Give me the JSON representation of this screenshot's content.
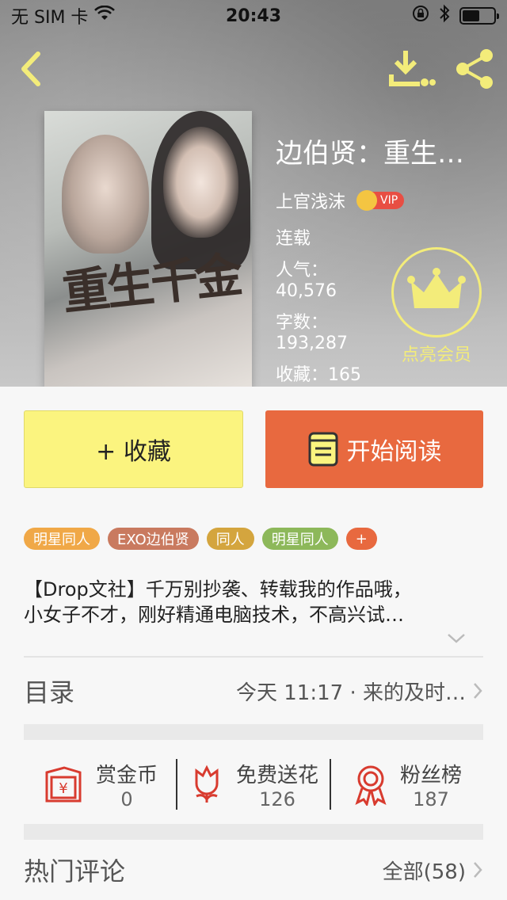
{
  "status_bar": {
    "carrier": "无 SIM 卡",
    "time": "20:43",
    "icons": [
      "wifi-icon",
      "rotation-lock-icon",
      "bluetooth-icon",
      "battery-icon"
    ]
  },
  "nav": {
    "icons": [
      "back-arrow-icon",
      "download-icon",
      "share-icon"
    ],
    "accent": "#f3ec7a"
  },
  "book": {
    "title": "边伯贤：重生…",
    "author": "上官浅沫",
    "vip_label": "VIP",
    "status": "连载",
    "popularity_label": "人气：",
    "popularity_value": "40,576",
    "words_label": "字数：",
    "words_value": "193,287",
    "favorites": "收藏：165",
    "cover_art_text": "重生千金"
  },
  "vip_member": {
    "label": "点亮会员",
    "icon": "crown-icon"
  },
  "actions": {
    "favorite_label": "+ 收藏",
    "read_label": "开始阅读",
    "favorite_color": "#fbf47f",
    "read_color": "#e8693f"
  },
  "tags": [
    {
      "label": "明星同人",
      "color": "#f0a847"
    },
    {
      "label": "EXO边伯贤",
      "color": "#c97a5f"
    },
    {
      "label": "同人",
      "color": "#d4a53e"
    },
    {
      "label": "明星同人",
      "color": "#8db85a"
    },
    {
      "label": "+",
      "color": "#e8693f"
    }
  ],
  "description": {
    "line1": "【Drop文社】千万别抄袭、转载我的作品哦，",
    "line2": "小女子不才，刚好精通电脑技术，不高兴试…"
  },
  "toc": {
    "title": "目录",
    "latest": "今天 11:17 · 来的及时…"
  },
  "stats": [
    {
      "label": "赏金币",
      "value": "0",
      "icon": "red-envelope-icon"
    },
    {
      "label": "免费送花",
      "value": "126",
      "icon": "flower-icon"
    },
    {
      "label": "粉丝榜",
      "value": "187",
      "icon": "medal-icon"
    }
  ],
  "comments": {
    "title": "热门评论",
    "all_label": "全部(58)"
  }
}
